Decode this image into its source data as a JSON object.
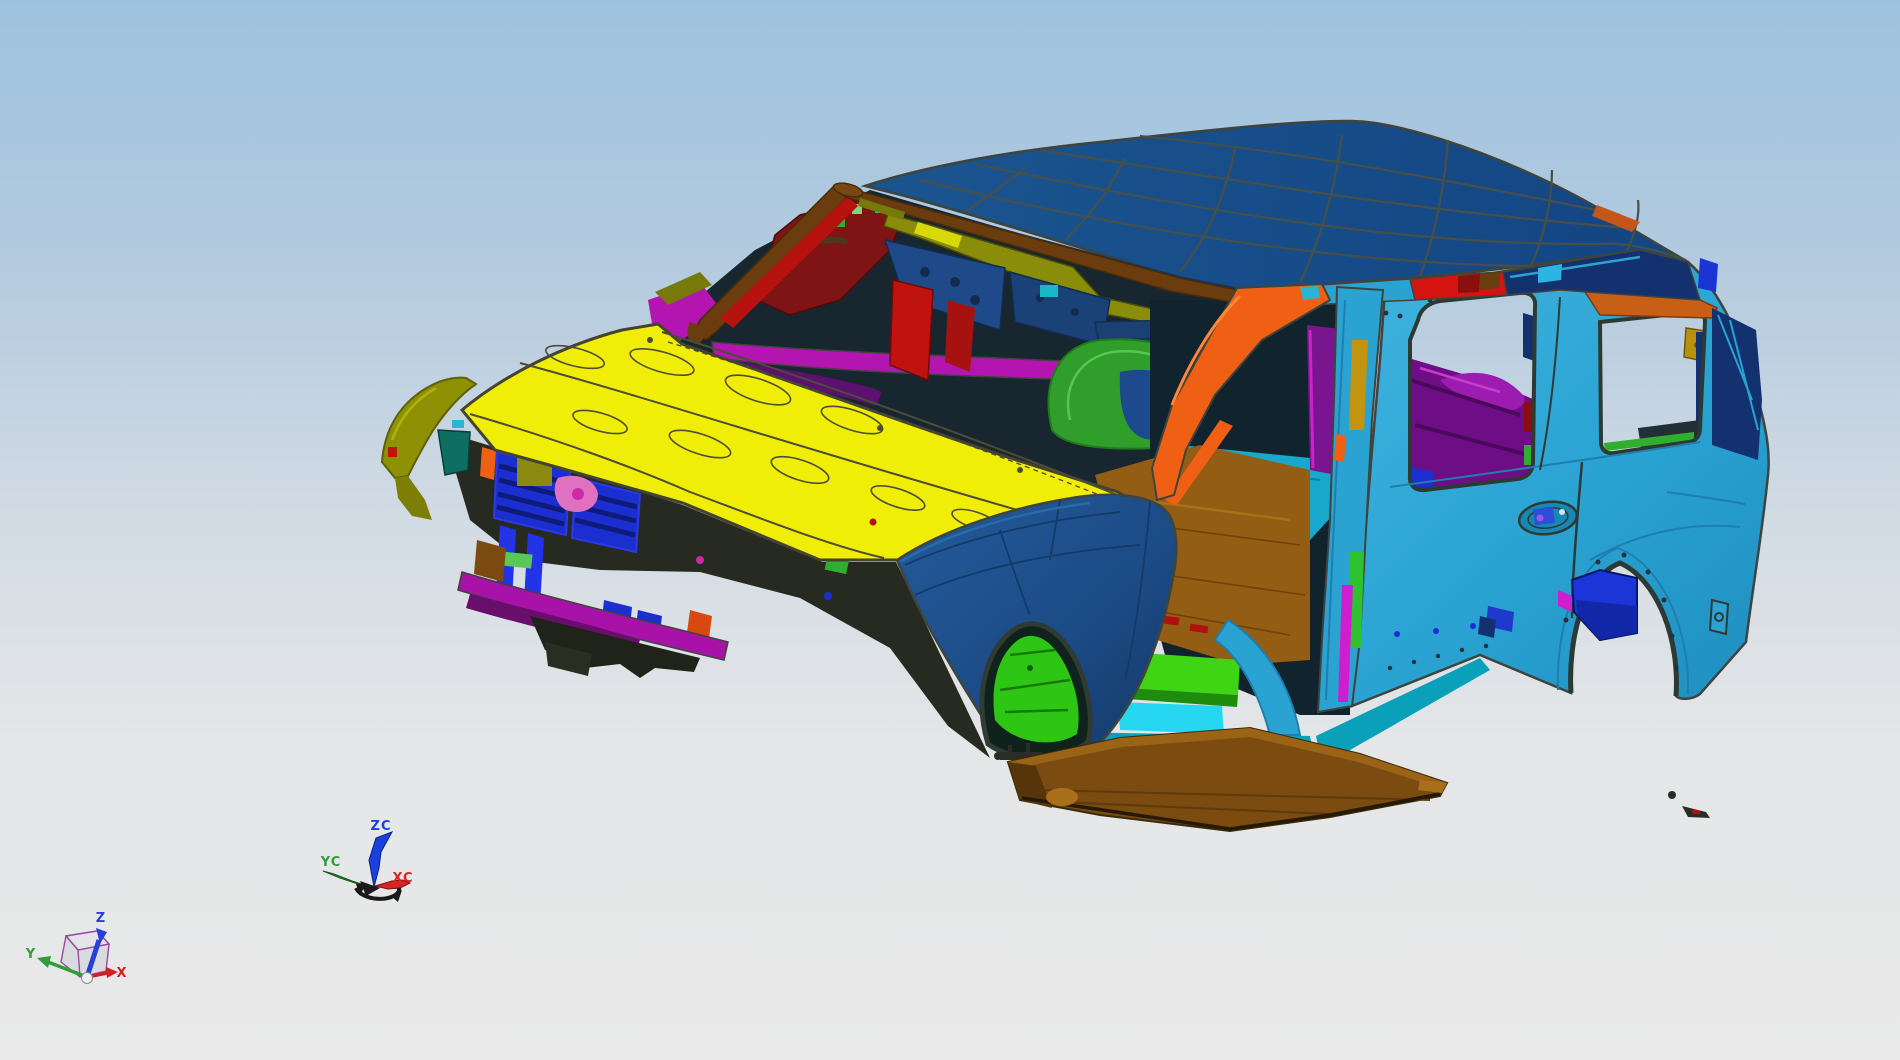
{
  "scene": {
    "description": "CAD 3D viewport showing a body-in-white SUV car body model in isometric view",
    "background": {
      "top": "#9dc2df",
      "upper_mid": "#b5cbdf",
      "lower_mid": "#d3dce4",
      "bottom": "#e9e9e9"
    }
  },
  "model": {
    "name": "car-body-in-white",
    "parts": [
      {
        "name": "roof-panel",
        "color": "#174c8c"
      },
      {
        "name": "hood-panel",
        "color": "#f0ee06"
      },
      {
        "name": "front-fender-right",
        "color": "#1c4b85"
      },
      {
        "name": "front-fender-left",
        "color": "#8f9105"
      },
      {
        "name": "a-pillar-outer",
        "color": "#ef5f14"
      },
      {
        "name": "a-pillar-inner",
        "color": "#b51210"
      },
      {
        "name": "roof-rail-trim",
        "color": "#6b3c0e"
      },
      {
        "name": "header-rail",
        "color": "#8a8d0a"
      },
      {
        "name": "body-side-quarter",
        "color": "#2aa3d3"
      },
      {
        "name": "b-pillar",
        "color": "#2aa3d3"
      },
      {
        "name": "rocker-step",
        "color": "#7c4b10"
      },
      {
        "name": "radiator-support",
        "color": "#1b2fd0"
      },
      {
        "name": "front-crossmember",
        "color": "#a812a8"
      },
      {
        "name": "floor-pan",
        "color": "#935d13"
      },
      {
        "name": "floor-reinforcement",
        "color": "#2ec615"
      },
      {
        "name": "seat-frame",
        "color": "#2f9e2b"
      },
      {
        "name": "quarter-trim-panel",
        "color": "#7a1590"
      },
      {
        "name": "wheelhouse-liner",
        "color": "#1b35d8"
      },
      {
        "name": "dash-panel",
        "color": "#1b4075"
      },
      {
        "name": "sill-inner",
        "color": "#0aa0ba"
      }
    ]
  },
  "wcs_triad": {
    "z_label": "ZC",
    "y_label": "YC",
    "x_label": "XC",
    "z_color": "#1b41dd",
    "y_color": "#2f9e38",
    "x_color": "#d42525",
    "handle_color": "#1a1a1a"
  },
  "abs_triad": {
    "z_label": "Z",
    "y_label": "Y",
    "x_label": "X",
    "z_color": "#2741d8",
    "y_color": "#2f9e38",
    "x_color": "#d02020",
    "cube_edge_color": "#9a4aa0"
  }
}
